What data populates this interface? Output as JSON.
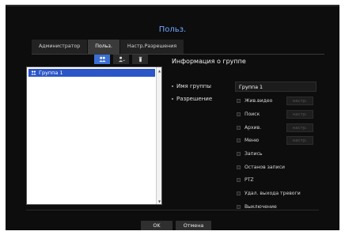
{
  "dialog": {
    "title": "Польз."
  },
  "tabs": [
    {
      "label": "Администратор",
      "active": false
    },
    {
      "label": "Польз.",
      "active": true
    },
    {
      "label": "Настр.Разрешения",
      "active": false
    }
  ],
  "toolbar": {
    "icons": [
      "add-group-icon",
      "add-user-icon",
      "delete-icon"
    ]
  },
  "group_list": {
    "items": [
      {
        "label": "Группа 1",
        "selected": true
      }
    ]
  },
  "group_info": {
    "title": "Информация о группе",
    "name_label": "Имя группы",
    "name_value": "Группа 1",
    "permission_label": "Разрешение"
  },
  "permissions": [
    {
      "label": "Жив.видео",
      "has_settings": true
    },
    {
      "label": "Поиск",
      "has_settings": true
    },
    {
      "label": "Архив.",
      "has_settings": true
    },
    {
      "label": "Меню",
      "has_settings": true
    },
    {
      "label": "Запись",
      "has_settings": false
    },
    {
      "label": "Останов записи",
      "has_settings": false
    },
    {
      "label": "PTZ",
      "has_settings": false
    },
    {
      "label": "Удал. выхода тревоги",
      "has_settings": false
    },
    {
      "label": "Выключение",
      "has_settings": false
    }
  ],
  "settings_button_label": "настр.",
  "footer": {
    "ok_label": "OK",
    "cancel_label": "Отмена"
  },
  "colors": {
    "accent": "#3b6fd4",
    "title": "#6fa6ff",
    "background": "#0d0d0d"
  }
}
